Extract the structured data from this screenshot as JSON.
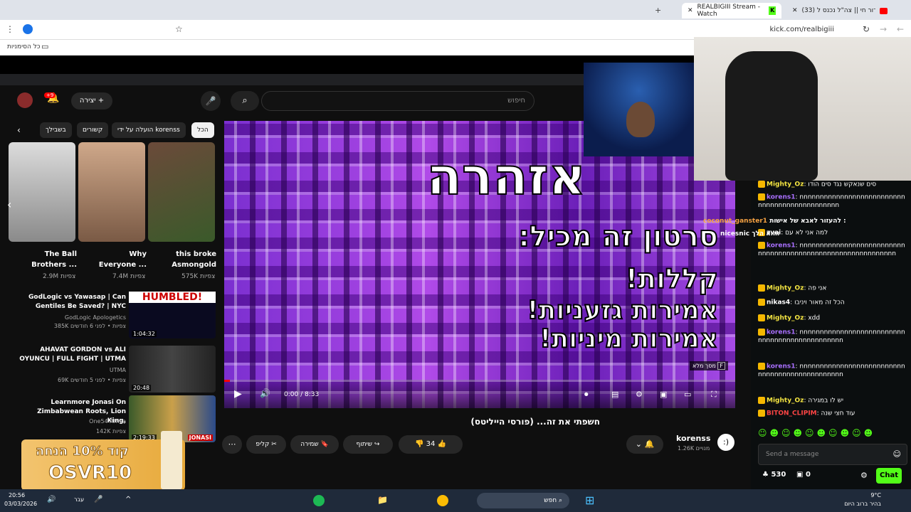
{
  "browser": {
    "tabs": [
      {
        "label": "REALBIGIII Stream - Watch"
      },
      {
        "label": "(33) שידור חי || צה\"ל נכנס ל"
      }
    ],
    "url": "kick.com/realbigiii",
    "bookmark_folder": "כל הסימניות"
  },
  "youtube": {
    "search_placeholder": "חיפוש",
    "create_label": "יצירה",
    "notifications_count": "+9",
    "chips": [
      "הכל",
      "הועלה על ידי korenss",
      "קשורים",
      "בשבילך"
    ],
    "shorts": [
      {
        "title_line1": "this broke",
        "title_line2": "Asmongold",
        "views": "575K צפיות"
      },
      {
        "title_line1": "Why",
        "title_line2": "Everyone ...",
        "views": "7.4M צפיות"
      },
      {
        "title_line1": "The Ball",
        "title_line2": "Brothers ...",
        "views": "2.9M צפיות"
      }
    ],
    "recommended": [
      {
        "title": "GodLogic vs Yawasap | Can Gentiles Be Saved? | NYC",
        "channel": "GodLogic Apologetics",
        "meta": "385K צפיות • לפני 6 חודשים",
        "duration": "1:04:32",
        "thumb_text": "HUMBLED!"
      },
      {
        "title": "AHAVAT GORDON vs ALI OYUNCU | FULL FIGHT | UTMA",
        "channel": "UTMA",
        "meta": "69K צפיות • לפני 5 חודשים",
        "duration": "20:48",
        "thumb_text": ""
      },
      {
        "title": "Learnmore Jonasi On Zimbabwean Roots, Lion King,",
        "channel": "One54 Africa",
        "meta": "142K צפיות",
        "duration": "2:19:33",
        "thumb_text": "JONASI"
      }
    ],
    "player": {
      "warning_title": "אזהרה",
      "line1": "סרטון זה מכיל:",
      "line2": "קללות!",
      "line3": "אמירות גזעניות!",
      "line4": "אמירות מיניות!",
      "time": "0:00 / 8:33",
      "fullscreen_hint": "מסך מלא",
      "fullscreen_key": "F"
    },
    "video_title": "חשפתי את זה... (פורסי הייליטס)",
    "channel_name": "korenss",
    "subscribers": "1.26K מנויים",
    "likes": "34",
    "share_label": "שיתוף",
    "save_label": "שמירה",
    "clip_label": "קליפ"
  },
  "chat": {
    "overlay_lines": [
      {
        "user": "coconut_ganster1",
        "text": "להעזור לאבא של אישות :"
      },
      {
        "user": "nicesnic",
        "text": "והוא הלך"
      }
    ],
    "messages": [
      {
        "user": "Mighty_Oz",
        "text": "סים שנאקש נגד סים הודו",
        "color": "#f5e642"
      },
      {
        "user": "korens1",
        "text": "nnnnnnnnnnnnnnnnnnnnnnnnnnnnnnnnnnnnnnnnnnnnnn",
        "color": "#a970ff"
      },
      {
        "user": "zvai",
        "text": "למה אני לא עם",
        "color": "#ffffff"
      },
      {
        "user": "korens1",
        "text": "nnnnnnnnnnnnnnnnnnnnnnnnnnnnnnnnnnnnnnnnnnnnnnnnnnnnnnnnnnnn",
        "color": "#a970ff"
      },
      {
        "user": "Mighty_Oz",
        "text": "אני פה",
        "color": "#f5e642"
      },
      {
        "user": "nikas4",
        "text": "הכל זה מאור ויניבו",
        "color": "#ffffff"
      },
      {
        "user": "Mighty_Oz",
        "text": "xdd",
        "color": "#f5e642"
      },
      {
        "user": "korens1",
        "text": "nnnnnnnnnnnnnnnnnnnnnnnnnnnnnnnnnnnnnnnnnnnnnnn",
        "color": "#a970ff"
      },
      {
        "user": "korens1",
        "text": "nnnnnnnnnnnnnnnnnnnnnnnnnnnnnnnnnnnnnnnnnnnnnnn",
        "color": "#a970ff"
      },
      {
        "user": "Mighty_Oz",
        "text": "יש לו במגירה",
        "color": "#f5e642"
      },
      {
        "user": "BITON_CLIPIM",
        "text": "עוד חצי שנה",
        "color": "#ff4545"
      }
    ],
    "input_placeholder": "Send a message",
    "points": "530",
    "gifts": "0",
    "chat_button": "Chat"
  },
  "promo": {
    "line1": "קוד 10% הנחה",
    "code": "OSVR10"
  },
  "taskbar": {
    "time": "20:56",
    "date": "03/03/2026",
    "lang": "עבר",
    "search": "חפש",
    "weather_temp": "9°C",
    "weather_desc": "בהיר ברוב היום"
  },
  "colors": {
    "kick_green": "#53fc18",
    "yt_bg": "#0f0f0f",
    "purple": "#9b3ee0"
  }
}
